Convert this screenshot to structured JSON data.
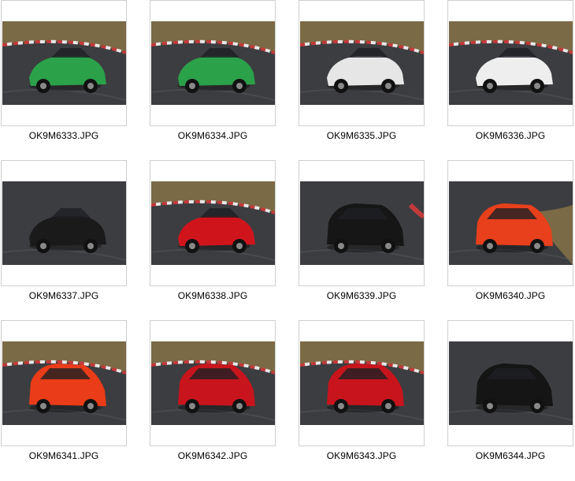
{
  "files": [
    {
      "name": "OK9M6333.JPG",
      "thumb": "green-roadster-thumbnail",
      "color": "#2ba14a",
      "scene": "track-grass",
      "car": "roadster"
    },
    {
      "name": "OK9M6334.JPG",
      "thumb": "green-roadster-thumbnail",
      "color": "#2ba14a",
      "scene": "grass-top",
      "car": "roadster"
    },
    {
      "name": "OK9M6335.JPG",
      "thumb": "white-convertible-thumbnail",
      "color": "#e6e6e6",
      "scene": "kerb-grass",
      "car": "convertible"
    },
    {
      "name": "OK9M6336.JPG",
      "thumb": "white-coupe-thumbnail",
      "color": "#eeeeee",
      "scene": "grass-top",
      "car": "coupe"
    },
    {
      "name": "OK9M6337.JPG",
      "thumb": "black-coupe-thumbnail",
      "color": "#1a1a1a",
      "scene": "track-cars",
      "car": "coupe"
    },
    {
      "name": "OK9M6338.JPG",
      "thumb": "red-roadster-thumbnail",
      "color": "#d0141c",
      "scene": "kerb-grass",
      "car": "roadster"
    },
    {
      "name": "OK9M6339.JPG",
      "thumb": "black-hatchback-thumbnail",
      "color": "#161616",
      "scene": "track-kerb-right",
      "car": "hatch"
    },
    {
      "name": "OK9M6340.JPG",
      "thumb": "orange-hatchback-thumbnail",
      "color": "#e8401c",
      "scene": "grass-right",
      "car": "hatch"
    },
    {
      "name": "OK9M6341.JPG",
      "thumb": "orange-hatchback-thumbnail",
      "color": "#ea3c18",
      "scene": "grass-top",
      "car": "hatch"
    },
    {
      "name": "OK9M6342.JPG",
      "thumb": "red-hatchback-thumbnail",
      "color": "#c8141c",
      "scene": "kerb-grass",
      "car": "hatch"
    },
    {
      "name": "OK9M6343.JPG",
      "thumb": "red-hatchback-thumbnail",
      "color": "#c8141c",
      "scene": "grass-top",
      "car": "hatch"
    },
    {
      "name": "OK9M6344.JPG",
      "thumb": "black-hatchback-thumbnail",
      "color": "#151515",
      "scene": "track-plain",
      "car": "hatch"
    }
  ],
  "colors": {
    "asphalt": "#3c3d40",
    "asphalt_light": "#55575b",
    "grass": "#7a6a45",
    "kerb_red": "#c23a3a",
    "kerb_white": "#e8e8e8",
    "border": "#cfcfcf"
  }
}
